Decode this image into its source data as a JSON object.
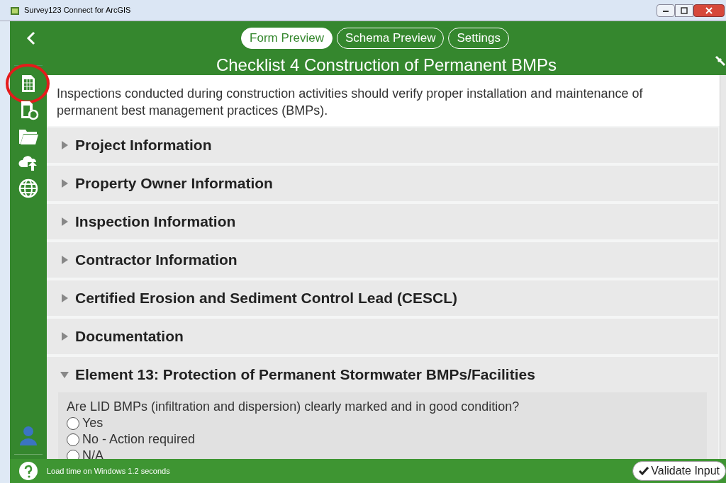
{
  "window": {
    "title": "Survey123 Connect for ArcGIS"
  },
  "tabs": [
    {
      "label": "Form Preview",
      "selected": true
    },
    {
      "label": "Schema Preview",
      "selected": false
    },
    {
      "label": "Settings",
      "selected": false
    }
  ],
  "form": {
    "title": "Checklist 4 Construction of Permanent BMPs",
    "description": "Inspections conducted during construction activities should verify proper installation and maintenance of permanent best management practices (BMPs).",
    "groups": [
      {
        "label": "Project Information",
        "expanded": false
      },
      {
        "label": "Property Owner Information",
        "expanded": false
      },
      {
        "label": "Inspection Information",
        "expanded": false
      },
      {
        "label": "Contractor Information",
        "expanded": false
      },
      {
        "label": "Certified Erosion and Sediment Control Lead (CESCL)",
        "expanded": false
      },
      {
        "label": "Documentation",
        "expanded": false
      },
      {
        "label": "Element 13: Protection of Permanent Stormwater BMPs/Facilities",
        "expanded": true,
        "question": {
          "label": "Are LID BMPs (infiltration and dispersion) clearly marked and in good condition?",
          "options": [
            {
              "label": "Yes",
              "selected": false
            },
            {
              "label": "No - Action required",
              "selected": false
            },
            {
              "label": "N/A",
              "selected": false
            }
          ]
        }
      }
    ]
  },
  "status_bar": {
    "text": "Load time on Windows 1.2 seconds",
    "button": "Validate Input"
  }
}
